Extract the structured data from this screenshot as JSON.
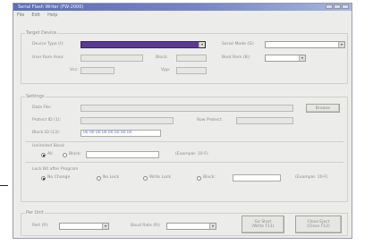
{
  "window": {
    "title": "Serial Flash Writer (FW-2000)",
    "menu": [
      "File",
      "Edit",
      "Help"
    ]
  },
  "target_device": {
    "title": "Target Device",
    "device_type_label": "Device Type (I):",
    "serial_mode_label": "Serial Mode (S):",
    "user_rom_area_label": "User Rom Area:",
    "block_label": "Block:",
    "boot_rom_label": "Boot Rom (B):",
    "vcc_label": "Vcc:",
    "vpp_label": "Vpp:"
  },
  "settings": {
    "title": "Settings",
    "data_file_label": "Data File:",
    "browse_button": "Browse",
    "protect_id_label": "Protect ID (1):",
    "row_protect_label": "Row Protect:",
    "block_id_label": "Block ID (13):",
    "block_id_value": "00 00 00 00 00 00 00 00",
    "erase_block": {
      "title": "Unlimited Block",
      "all_label": "All",
      "block_label": "Block:",
      "example": "(Example: 10-F)"
    },
    "lock_bit": {
      "title": "Lock Bit after Program",
      "no_change": "No Change",
      "no_lock": "No Lock",
      "write_lock": "Write Lock",
      "block": "Block:",
      "example": "(Example: 10-F)"
    }
  },
  "bottom": {
    "title": "Per Unit",
    "port_label": "Port (P):",
    "baud_rate_label": "Baud Rate (R):",
    "btn_program_line1": "Go Start",
    "btn_program_line2": "(Write F11)",
    "btn_close_line1": "Close Eject",
    "btn_close_line2": "(Close F12)"
  },
  "colors": {
    "title_start": "#5d6cb4",
    "title_end": "#a9b6df",
    "selected_combo": "#5b3a93",
    "hex_text": "#5b6ad0"
  }
}
